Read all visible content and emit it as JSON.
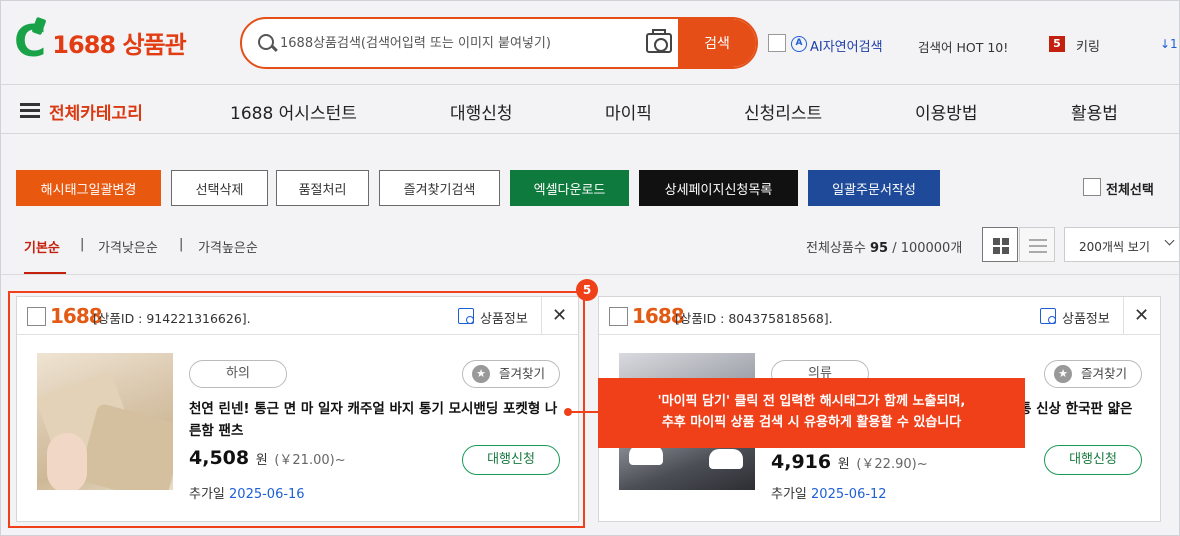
{
  "header": {
    "logo_text": "1688 상품관",
    "search": {
      "placeholder": "1688상품검색(검색어입력 또는 이미지 붙여넣기)",
      "button_label": "검색"
    },
    "ai_search_label": "AI자연어검색",
    "ai_icon_glyph": "A",
    "hot_label": "검색어 HOT 10!",
    "rank_number": "5",
    "rank_keyword": "키링",
    "rank_next": "↓1"
  },
  "nav": {
    "all_categories": "전체카테고리",
    "items": [
      "1688 어시스턴트",
      "대행신청",
      "마이픽",
      "신청리스트",
      "이용방법",
      "활용법"
    ]
  },
  "toolbar": {
    "buttons": [
      "해시태그일괄변경",
      "선택삭제",
      "품절처리",
      "즐겨찾기검색",
      "엑셀다운로드",
      "상세페이지신청목록",
      "일괄주문서작성"
    ],
    "select_all_label": "전체선택"
  },
  "sort": {
    "options": [
      "기본순",
      "가격낮은순",
      "가격높은순"
    ],
    "separator": "|",
    "active": "기본순",
    "total_label": "전체상품수",
    "total_count": "95",
    "total_max": "/ 100000개",
    "per_page": "200개씩 보기"
  },
  "products": [
    {
      "logo": "1688",
      "id_text": "[상품ID : 914221316626].",
      "info_label": "상품정보",
      "close": "✕",
      "category": "하의",
      "fav_label": "즐겨찾기",
      "star": "★",
      "title": "천연 린넨! 통근 면 마 일자 캐주얼 바지 통기 모시밴딩 포켓형 나른함 팬츠",
      "price": "4,508",
      "unit": "원",
      "price_sub": "(￥21.00)~",
      "apply_label": "대행신청",
      "date_label": "추가일",
      "date": "2025-06-16"
    },
    {
      "logo": "1688",
      "id_text": "[상품ID : 804375818568].",
      "info_label": "상품정보",
      "close": "✕",
      "category": "의류",
      "fav_label": "즐겨찾기",
      "star": "★",
      "title": "통 신상 한국판 얇은",
      "price": "4,916",
      "unit": "원",
      "price_sub": "(￥22.90)~",
      "apply_label": "대행신청",
      "date_label": "추가일",
      "date": "2025-06-12"
    }
  ],
  "annotation": {
    "badge": "5",
    "callout_line1": "'마이픽 담기' 클릭 전 입력한 해시태그가 함께 노출되며,",
    "callout_line2": "추후 마이픽 상품 검색 시 유용하게 활용할 수 있습니다"
  },
  "colors": {
    "brand_orange": "#e54e17",
    "highlight_red": "#f0401a",
    "brand_green": "#19a248",
    "link_blue": "#1e5fd6"
  }
}
